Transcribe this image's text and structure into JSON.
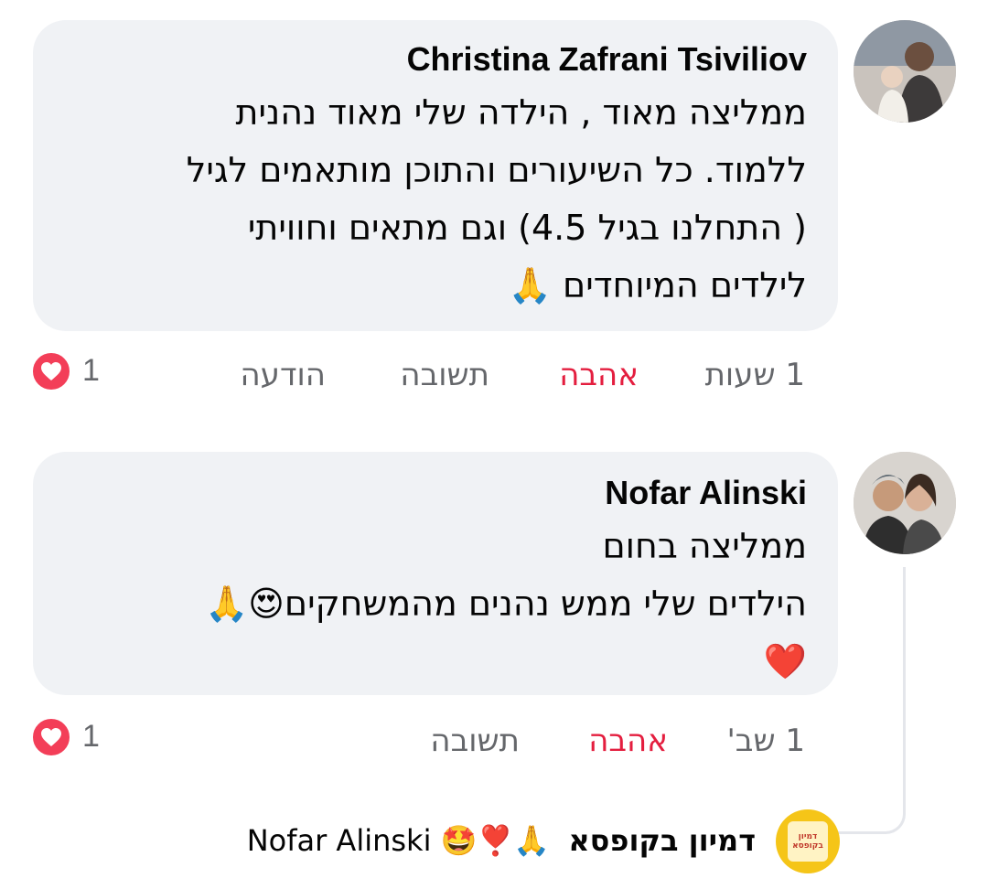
{
  "comments": [
    {
      "author": "Christina Zafrani Tsiviliov",
      "lines": [
        "ממליצה מאוד , הילדה שלי מאוד נהנית",
        "ללמוד. כל השיעורים והתוכן מותאמים לגיל",
        "( התחלנו בגיל 4.5) וגם מתאים וחוויתי",
        "לילדים המיוחדים 🙏"
      ],
      "time": "1 שעות",
      "love_label": "אהבה",
      "reply_label": "תשובה",
      "message_label": "הודעה",
      "reaction_count": "1"
    },
    {
      "author": "Nofar Alinski",
      "lines": [
        "ממליצה בחום",
        "הילדים שלי ממש נהנים מהמשחקים😍🙏",
        "❤️"
      ],
      "time": "1 שב'",
      "love_label": "אהבה",
      "reply_label": "תשובה",
      "reaction_count": "1"
    }
  ],
  "reply_preview": {
    "author": "דמיון בקופסא",
    "text": "🙏❣️🤩 Nofar Alinski",
    "avatar_text": "דמיון בקופסא"
  },
  "colors": {
    "bubble": "#f0f2f5",
    "love": "#e41e3f",
    "meta": "#65676b",
    "heart_badge": "#f33e58"
  }
}
